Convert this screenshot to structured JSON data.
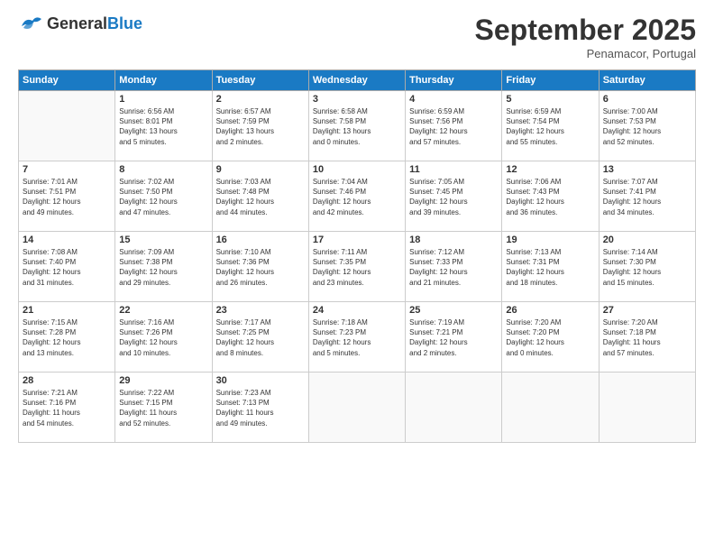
{
  "header": {
    "logo_general": "General",
    "logo_blue": "Blue",
    "month_title": "September 2025",
    "subtitle": "Penamacor, Portugal"
  },
  "weekdays": [
    "Sunday",
    "Monday",
    "Tuesday",
    "Wednesday",
    "Thursday",
    "Friday",
    "Saturday"
  ],
  "weeks": [
    [
      {
        "day": "",
        "info": ""
      },
      {
        "day": "1",
        "info": "Sunrise: 6:56 AM\nSunset: 8:01 PM\nDaylight: 13 hours\nand 5 minutes."
      },
      {
        "day": "2",
        "info": "Sunrise: 6:57 AM\nSunset: 7:59 PM\nDaylight: 13 hours\nand 2 minutes."
      },
      {
        "day": "3",
        "info": "Sunrise: 6:58 AM\nSunset: 7:58 PM\nDaylight: 13 hours\nand 0 minutes."
      },
      {
        "day": "4",
        "info": "Sunrise: 6:59 AM\nSunset: 7:56 PM\nDaylight: 12 hours\nand 57 minutes."
      },
      {
        "day": "5",
        "info": "Sunrise: 6:59 AM\nSunset: 7:54 PM\nDaylight: 12 hours\nand 55 minutes."
      },
      {
        "day": "6",
        "info": "Sunrise: 7:00 AM\nSunset: 7:53 PM\nDaylight: 12 hours\nand 52 minutes."
      }
    ],
    [
      {
        "day": "7",
        "info": "Sunrise: 7:01 AM\nSunset: 7:51 PM\nDaylight: 12 hours\nand 49 minutes."
      },
      {
        "day": "8",
        "info": "Sunrise: 7:02 AM\nSunset: 7:50 PM\nDaylight: 12 hours\nand 47 minutes."
      },
      {
        "day": "9",
        "info": "Sunrise: 7:03 AM\nSunset: 7:48 PM\nDaylight: 12 hours\nand 44 minutes."
      },
      {
        "day": "10",
        "info": "Sunrise: 7:04 AM\nSunset: 7:46 PM\nDaylight: 12 hours\nand 42 minutes."
      },
      {
        "day": "11",
        "info": "Sunrise: 7:05 AM\nSunset: 7:45 PM\nDaylight: 12 hours\nand 39 minutes."
      },
      {
        "day": "12",
        "info": "Sunrise: 7:06 AM\nSunset: 7:43 PM\nDaylight: 12 hours\nand 36 minutes."
      },
      {
        "day": "13",
        "info": "Sunrise: 7:07 AM\nSunset: 7:41 PM\nDaylight: 12 hours\nand 34 minutes."
      }
    ],
    [
      {
        "day": "14",
        "info": "Sunrise: 7:08 AM\nSunset: 7:40 PM\nDaylight: 12 hours\nand 31 minutes."
      },
      {
        "day": "15",
        "info": "Sunrise: 7:09 AM\nSunset: 7:38 PM\nDaylight: 12 hours\nand 29 minutes."
      },
      {
        "day": "16",
        "info": "Sunrise: 7:10 AM\nSunset: 7:36 PM\nDaylight: 12 hours\nand 26 minutes."
      },
      {
        "day": "17",
        "info": "Sunrise: 7:11 AM\nSunset: 7:35 PM\nDaylight: 12 hours\nand 23 minutes."
      },
      {
        "day": "18",
        "info": "Sunrise: 7:12 AM\nSunset: 7:33 PM\nDaylight: 12 hours\nand 21 minutes."
      },
      {
        "day": "19",
        "info": "Sunrise: 7:13 AM\nSunset: 7:31 PM\nDaylight: 12 hours\nand 18 minutes."
      },
      {
        "day": "20",
        "info": "Sunrise: 7:14 AM\nSunset: 7:30 PM\nDaylight: 12 hours\nand 15 minutes."
      }
    ],
    [
      {
        "day": "21",
        "info": "Sunrise: 7:15 AM\nSunset: 7:28 PM\nDaylight: 12 hours\nand 13 minutes."
      },
      {
        "day": "22",
        "info": "Sunrise: 7:16 AM\nSunset: 7:26 PM\nDaylight: 12 hours\nand 10 minutes."
      },
      {
        "day": "23",
        "info": "Sunrise: 7:17 AM\nSunset: 7:25 PM\nDaylight: 12 hours\nand 8 minutes."
      },
      {
        "day": "24",
        "info": "Sunrise: 7:18 AM\nSunset: 7:23 PM\nDaylight: 12 hours\nand 5 minutes."
      },
      {
        "day": "25",
        "info": "Sunrise: 7:19 AM\nSunset: 7:21 PM\nDaylight: 12 hours\nand 2 minutes."
      },
      {
        "day": "26",
        "info": "Sunrise: 7:20 AM\nSunset: 7:20 PM\nDaylight: 12 hours\nand 0 minutes."
      },
      {
        "day": "27",
        "info": "Sunrise: 7:20 AM\nSunset: 7:18 PM\nDaylight: 11 hours\nand 57 minutes."
      }
    ],
    [
      {
        "day": "28",
        "info": "Sunrise: 7:21 AM\nSunset: 7:16 PM\nDaylight: 11 hours\nand 54 minutes."
      },
      {
        "day": "29",
        "info": "Sunrise: 7:22 AM\nSunset: 7:15 PM\nDaylight: 11 hours\nand 52 minutes."
      },
      {
        "day": "30",
        "info": "Sunrise: 7:23 AM\nSunset: 7:13 PM\nDaylight: 11 hours\nand 49 minutes."
      },
      {
        "day": "",
        "info": ""
      },
      {
        "day": "",
        "info": ""
      },
      {
        "day": "",
        "info": ""
      },
      {
        "day": "",
        "info": ""
      }
    ]
  ]
}
